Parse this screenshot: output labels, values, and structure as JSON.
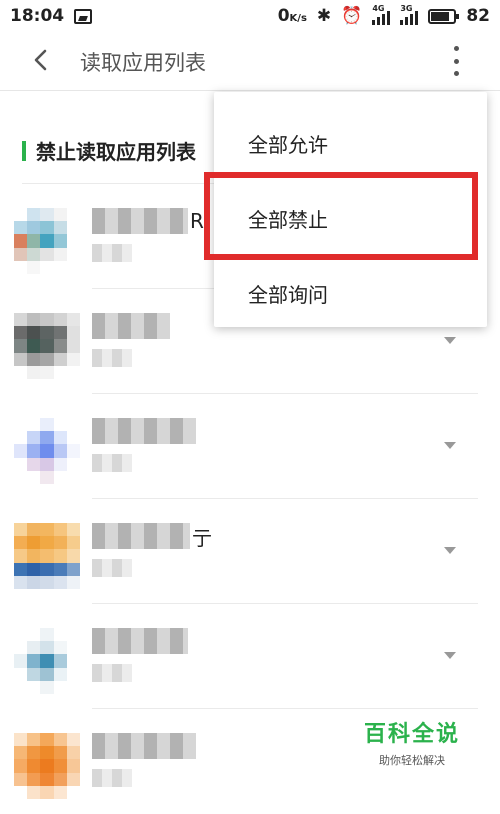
{
  "status_bar": {
    "time": "18:04",
    "net_speed": "0",
    "net_unit": "K/s",
    "signal1_tag": "4G",
    "signal2_tag": "3G",
    "battery_level": "82",
    "battery_fraction": 0.82
  },
  "header": {
    "title": "读取应用列表",
    "back_icon": "chevron-left-icon",
    "more_icon": "more-vertical-icon"
  },
  "section": {
    "title": "禁止读取应用列表",
    "accent_color": "#2bb24c"
  },
  "apps": [
    {
      "visible_char": "R"
    },
    {
      "visible_char": ""
    },
    {
      "visible_char": ""
    },
    {
      "visible_char": "亍"
    },
    {
      "visible_char": ""
    },
    {
      "visible_char": ""
    }
  ],
  "menu": {
    "items": [
      {
        "label": "全部允许"
      },
      {
        "label": "全部禁止"
      },
      {
        "label": "全部询问"
      }
    ],
    "highlight_color": "#e02b2b"
  },
  "watermark": {
    "title": "百科全说",
    "subtitle": "助你轻松解决"
  }
}
